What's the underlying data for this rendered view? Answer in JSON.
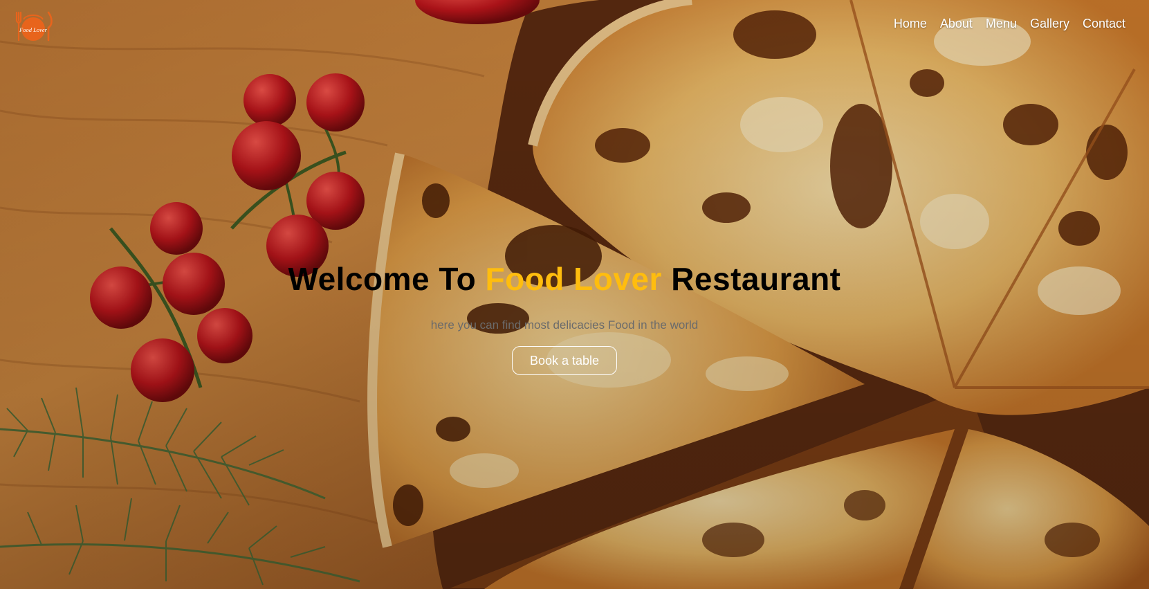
{
  "brand": {
    "logo_text": "Food Lover",
    "logo_color": "#e8641c"
  },
  "nav": {
    "items": [
      {
        "label": "Home"
      },
      {
        "label": "About"
      },
      {
        "label": "Menu"
      },
      {
        "label": "Gallery"
      },
      {
        "label": "Contact"
      }
    ]
  },
  "hero": {
    "title_prefix": "Welcome To ",
    "title_accent": "Food Lover",
    "title_suffix": " Restaurant",
    "accent_color": "#ffbd0e",
    "subtitle": "here you can find most delicacies Food in the world",
    "cta_label": "Book a table",
    "background": "pizza-on-wooden-board-photo"
  }
}
